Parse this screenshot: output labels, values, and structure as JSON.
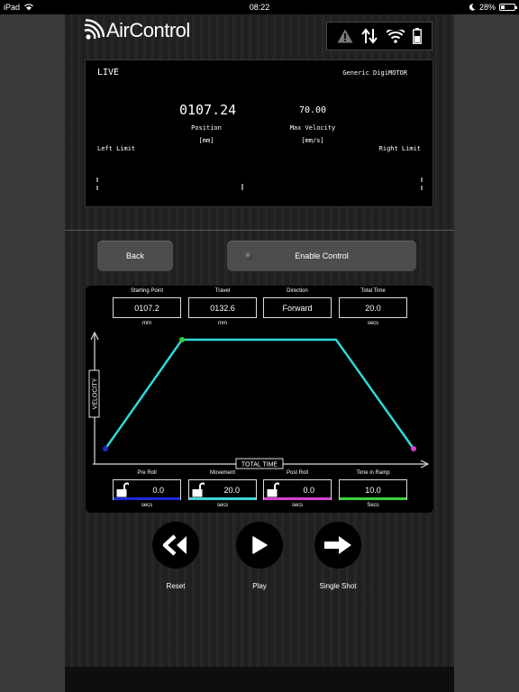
{
  "status_bar": {
    "device": "iPad",
    "time": "08:22",
    "battery": "28%",
    "battery_level": 0.28
  },
  "app": {
    "title": "AirControl"
  },
  "live": {
    "label": "LIVE",
    "motor": "Generic DigiMOTOR",
    "position": {
      "value": "0107.24",
      "label": "Position",
      "unit": "[mm]"
    },
    "velocity": {
      "value": "70.00",
      "label": "Max Velocity",
      "unit": "[mm/s]"
    },
    "left_limit": "Left Limit",
    "right_limit": "Right Limit"
  },
  "buttons": {
    "back": "Back",
    "enable": "Enable Control"
  },
  "fields": [
    {
      "header": "Starting Point",
      "value": "0107.2",
      "unit": "mm"
    },
    {
      "header": "Travel",
      "value": "0132.6",
      "unit": "mm"
    },
    {
      "header": "Direction",
      "value": "Forward",
      "unit": ""
    },
    {
      "header": "Total Time",
      "value": "20.0",
      "unit": "secs"
    }
  ],
  "axes": {
    "y_label": "VELOCITY",
    "x_label": "TOTAL TIME"
  },
  "timing": [
    {
      "header": "Pre Roll",
      "value": "0.0",
      "unit": "secs",
      "color": "#1e2bd6"
    },
    {
      "header": "Movement",
      "value": "20.0",
      "unit": "secs",
      "color": "#3fd4d6"
    },
    {
      "header": "Post Roll",
      "value": "0.0",
      "unit": "secs",
      "color": "#d63fd0"
    },
    {
      "header": "Time in Ramp",
      "value": "10.0",
      "unit": "Secs",
      "color": "#38d23a"
    }
  ],
  "transport": {
    "reset": "Reset",
    "play": "Play",
    "single_shot": "Single Shot"
  },
  "colors": {
    "profile_line": "#2fd8d8",
    "start_dot": "#1e2bd6",
    "peak_dot": "#2ed22e",
    "end_dot": "#d63fd0"
  }
}
